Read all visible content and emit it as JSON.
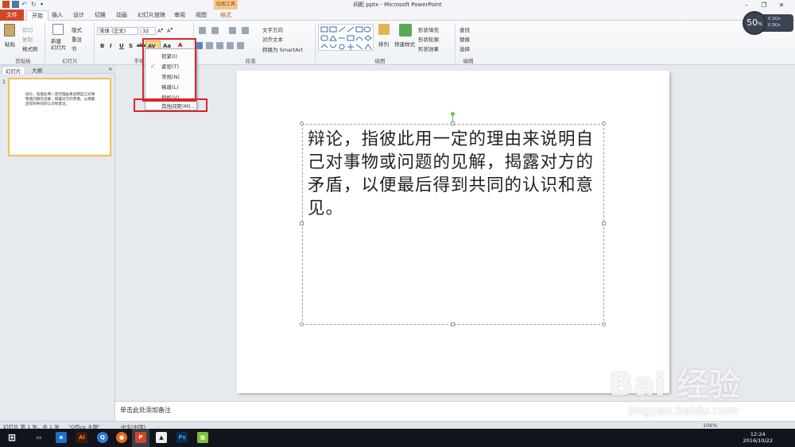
{
  "window": {
    "title": "间距.pptx - Microsoft PowerPoint",
    "context_group": "绘图工具",
    "min": "–",
    "max": "❐",
    "close": "✕"
  },
  "tabs": {
    "file": "文件",
    "home": "开始",
    "insert": "插入",
    "design": "设计",
    "transitions": "切换",
    "animations": "动画",
    "slideshow": "幻灯片放映",
    "review": "审阅",
    "view": "视图",
    "format": "格式"
  },
  "ribbon": {
    "clipboard": {
      "label": "剪贴板",
      "paste": "粘贴",
      "cut": "剪切",
      "copy": "复制",
      "format_painter": "格式刷"
    },
    "slides": {
      "label": "幻灯片",
      "new_slide": "新建\n幻灯片",
      "layout": "版式",
      "reset": "重设",
      "section": "节"
    },
    "font": {
      "label": "字体",
      "font_name": "宋体 (正文)",
      "font_size": "32",
      "bold": "B",
      "italic": "I",
      "underline": "U",
      "strike": "S",
      "shadow": "abc",
      "spacing": "AV",
      "case": "Aa",
      "color": "A"
    },
    "paragraph": {
      "label": "段落",
      "text_direction": "文字方向",
      "align_text": "对齐文本",
      "smartart": "转换为 SmartArt"
    },
    "drawing": {
      "label": "绘图",
      "arrange": "排列",
      "quick_styles": "快速样式",
      "shape_fill": "形状填充",
      "shape_outline": "形状轮廓",
      "shape_effects": "形状效果"
    },
    "editing": {
      "label": "编辑",
      "find": "查找",
      "replace": "替换",
      "select": "选择"
    }
  },
  "spacing_menu": {
    "items": [
      {
        "label": "很紧(I)",
        "checked": false
      },
      {
        "label": "紧密(T)",
        "checked": true
      },
      {
        "label": "常规(N)",
        "checked": false
      },
      {
        "label": "稀疏(L)",
        "checked": false
      },
      {
        "label": "很松(V)",
        "checked": false
      },
      {
        "label": "其他间距(M)...",
        "checked": false
      }
    ]
  },
  "left_pane": {
    "tab_slides": "幻灯片",
    "tab_outline": "大纲",
    "close": "×",
    "slide_number": "1",
    "thumb_text": "辩论，指彼此用一定的理由来说明自己对事物或问题的见解，揭露对方的矛盾，以便最后得到共同的认识和意见。"
  },
  "slide": {
    "text": "辩论，指彼此用一定的理由来说明自己对事物或问题的见解，揭露对方的矛盾，以便最后得到共同的认识和意见。"
  },
  "notes": {
    "placeholder": "单击此处添加备注"
  },
  "status": {
    "slide_info": "幻灯片 第 1 张，共 1 张",
    "theme": "\"Office 主题\"",
    "language": "中文(中国)",
    "zoom": "106%"
  },
  "taskbar": {
    "time": "12:24",
    "date": "2016/10/22"
  },
  "zoom_widget": {
    "percent": "50",
    "unit": "%",
    "line1": "0.1K/s",
    "line2": "0.3K/s"
  },
  "watermark": {
    "logo": "Bai 经验",
    "url": "jingyan.baidu.com"
  },
  "colors": {
    "file_tab": "#d24726",
    "highlight_box": "#d8262e",
    "thumb_border": "#f2c14e",
    "rotation_handle": "#6cc24a"
  }
}
